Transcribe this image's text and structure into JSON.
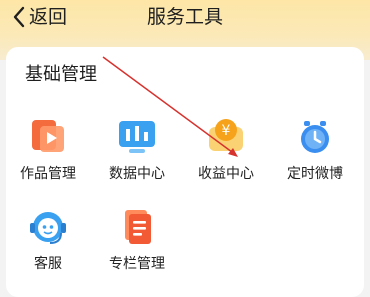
{
  "header": {
    "back_label": "返回",
    "title": "服务工具"
  },
  "section": {
    "title": "基础管理",
    "items": [
      {
        "label": "作品管理",
        "icon": "works-manage-icon"
      },
      {
        "label": "数据中心",
        "icon": "data-center-icon"
      },
      {
        "label": "收益中心",
        "icon": "revenue-center-icon"
      },
      {
        "label": "定时微博",
        "icon": "scheduled-weibo-icon"
      },
      {
        "label": "客服",
        "icon": "customer-service-icon"
      },
      {
        "label": "专栏管理",
        "icon": "column-manage-icon"
      }
    ]
  },
  "colors": {
    "header_gradient_top": "#fde6a6",
    "annotation_arrow": "#d6322e",
    "icon_orange": "#f46b3e",
    "icon_blue": "#3aa0f0",
    "icon_gold": "#f7b531"
  }
}
